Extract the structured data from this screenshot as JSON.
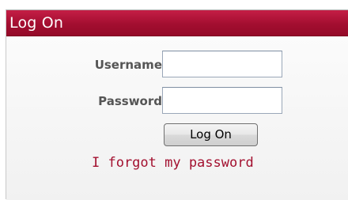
{
  "login_panel": {
    "title": "Log On",
    "username_label": "Username",
    "username_value": "",
    "password_label": "Password",
    "password_value": "",
    "submit_label": "Log On",
    "forgot_link": "I forgot my password"
  },
  "colors": {
    "header": "#a30e30",
    "link": "#a3102f",
    "label": "#555555"
  }
}
